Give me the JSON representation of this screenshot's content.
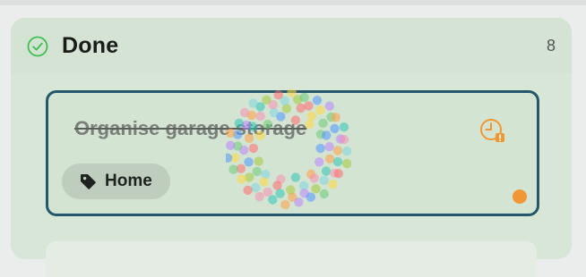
{
  "column": {
    "title": "Done",
    "count": "8",
    "icon": "check-circle-icon"
  },
  "card": {
    "title": "Organise garage storage",
    "completed": true,
    "tag": {
      "label": "Home",
      "icon": "tag-icon"
    },
    "alarm_icon": "alarm-clock-alert-icon",
    "priority_color": "#f19632",
    "border_color": "#24576a"
  },
  "colors": {
    "done_green": "#3fbf52",
    "alarm_orange": "#f19632",
    "column_bg": "#d7e6d6"
  }
}
